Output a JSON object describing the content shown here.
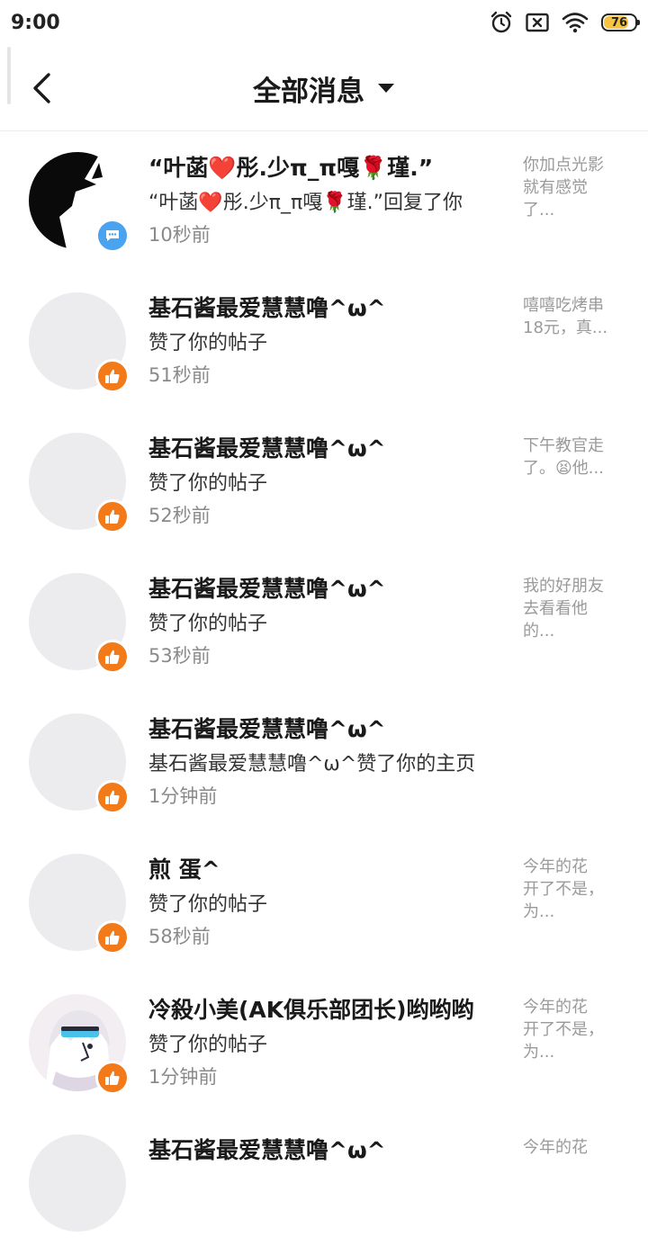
{
  "status_bar": {
    "time": "9:00",
    "battery_level": "76",
    "icons": [
      "alarm-icon",
      "sim-off-icon",
      "wifi-icon",
      "battery-icon"
    ],
    "battery_color": "#f6c342"
  },
  "header": {
    "title": "全部消息",
    "back_icon": "chevron-left-icon",
    "dropdown_icon": "caret-down-icon"
  },
  "colors": {
    "like_badge": "#f27a18",
    "reply_badge": "#4aa3ef",
    "secondary_text": "#8a8a8a"
  },
  "messages": [
    {
      "name": "“叶菡❤️彤.少π_π嘎🌹瑾.”",
      "action": "“叶菡❤️彤.少π_π嘎🌹瑾.”回复了你",
      "time": "10秒前",
      "preview": "你加点光影\n就有感觉\n了...",
      "badge": "reply-bubble-icon"
    },
    {
      "name": "基石酱最爱慧慧噜^ω^",
      "action": "赞了你的帖子",
      "time": "51秒前",
      "preview": "嘻嘻吃烤串\n18元，真...",
      "badge": "thumbs-up-icon"
    },
    {
      "name": "基石酱最爱慧慧噜^ω^",
      "action": "赞了你的帖子",
      "time": "52秒前",
      "preview": "下午教官走\n了。😫他...",
      "badge": "thumbs-up-icon"
    },
    {
      "name": "基石酱最爱慧慧噜^ω^",
      "action": "赞了你的帖子",
      "time": "53秒前",
      "preview": "我的好朋友\n去看看他\n的...",
      "badge": "thumbs-up-icon"
    },
    {
      "name": "基石酱最爱慧慧噜^ω^",
      "action": "基石酱最爱慧慧噜^ω^赞了你的主页",
      "time": "1分钟前",
      "preview": "",
      "badge": "thumbs-up-icon"
    },
    {
      "name": "煎 蛋^",
      "action": "赞了你的帖子",
      "time": "58秒前",
      "preview": "今年的花\n开了不是，\n为...",
      "badge": "thumbs-up-icon"
    },
    {
      "name": "冷殺小美(AK俱乐部团长)哟哟哟",
      "action": "赞了你的帖子",
      "time": "1分钟前",
      "preview": "今年的花\n开了不是，\n为...",
      "badge": "thumbs-up-icon"
    },
    {
      "name": "基石酱最爱慧慧噜^ω^",
      "action": "",
      "time": "",
      "preview": "今年的花",
      "badge": ""
    }
  ]
}
